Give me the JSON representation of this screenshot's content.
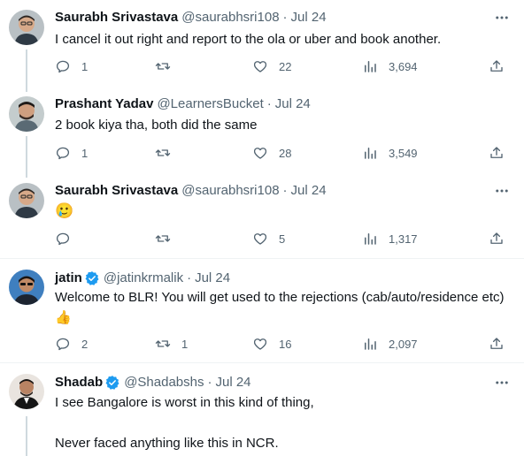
{
  "tweets": [
    {
      "name": "Saurabh Srivastava",
      "handle": "@saurabhsri108",
      "date": "Jul 24",
      "text": "I cancel it out right and report to the ola or uber and book another.",
      "replies": "1",
      "retweets": "",
      "likes": "22",
      "views": "3,694"
    },
    {
      "name": "Prashant Yadav",
      "handle": "@LearnersBucket",
      "date": "Jul 24",
      "text": "2 book kiya tha, both did the same",
      "replies": "1",
      "retweets": "",
      "likes": "28",
      "views": "3,549"
    },
    {
      "name": "Saurabh Srivastava",
      "handle": "@saurabhsri108",
      "date": "Jul 24",
      "text": "🥲",
      "replies": "",
      "retweets": "",
      "likes": "5",
      "views": "1,317"
    },
    {
      "name": "jatin",
      "handle": "@jatinkrmalik",
      "date": "Jul 24",
      "verified": true,
      "text": "Welcome to BLR! You will get used to the rejections (cab/auto/residence etc) 👍",
      "replies": "2",
      "retweets": "1",
      "likes": "16",
      "views": "2,097"
    },
    {
      "name": "Shadab",
      "handle": "@Shadabshs",
      "date": "Jul 24",
      "verified": true,
      "text": "I see Bangalore is worst in this kind of thing,\n\nNever faced anything like this in NCR."
    }
  ],
  "separator": "·",
  "icons": {
    "reply": "reply-icon",
    "retweet": "retweet-icon",
    "like": "heart-icon",
    "views": "views-icon",
    "share": "share-icon",
    "more": "more-icon",
    "verified": "verified-badge-icon"
  },
  "colors": {
    "text": "#0f1419",
    "secondary": "#536471",
    "verified": "#1d9bf0",
    "thread_line": "#cfd9de",
    "divider": "#eff3f4"
  }
}
